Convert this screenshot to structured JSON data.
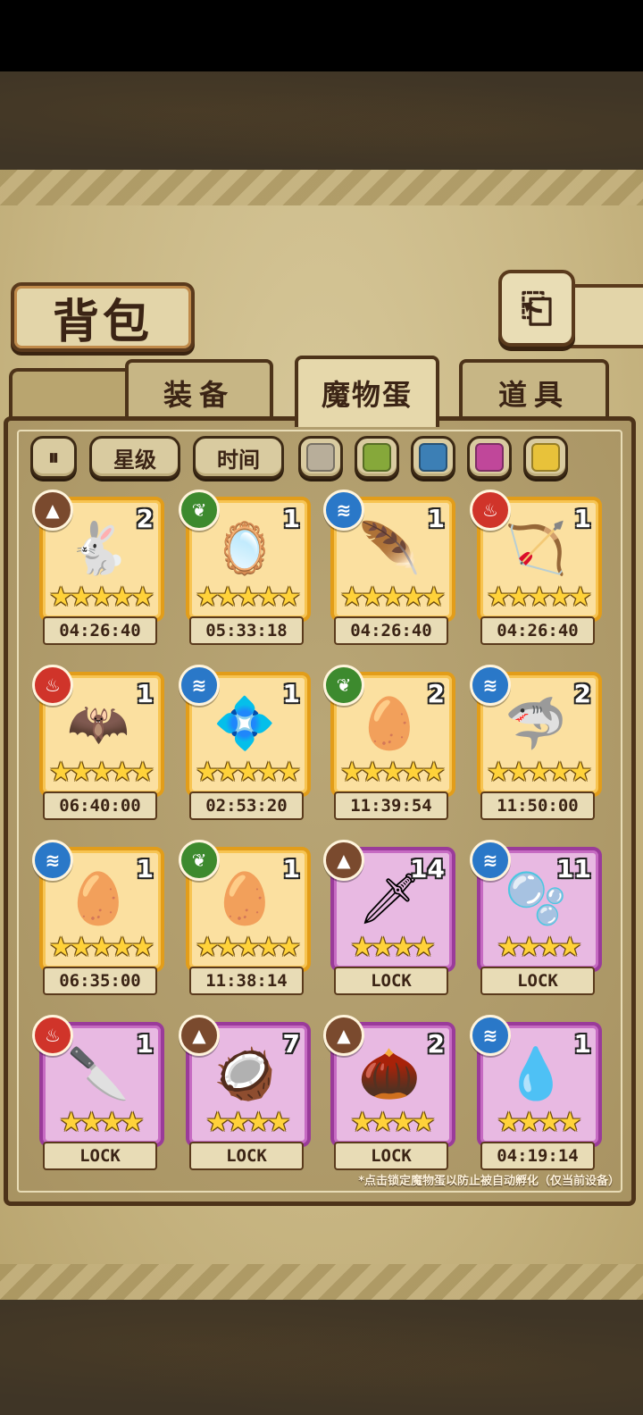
{
  "header": {
    "title": "背包",
    "back_icon": "⎗"
  },
  "tabs": [
    {
      "label": "装备",
      "active": false
    },
    {
      "label": "魔物蛋",
      "active": true
    },
    {
      "label": "道具",
      "active": false
    }
  ],
  "filters": {
    "toggle_icon": "⏸",
    "star_sort_label": "星级",
    "time_sort_label": "时间",
    "color_swatches": [
      "#b8ae9a",
      "#86a83a",
      "#3c7fb5",
      "#c0479a",
      "#e8c23a"
    ]
  },
  "element_colors": {
    "earth": "#7a4a2e",
    "nature": "#3d8a2e",
    "water": "#2a78c8",
    "fire": "#d0342a"
  },
  "element_icons": {
    "earth": "▲",
    "nature": "❦",
    "water": "≋",
    "fire": "♨"
  },
  "eggs": [
    {
      "element": "earth",
      "count": "2",
      "stars": "★★★★★",
      "timer": "04:26:40",
      "rarity": "gold",
      "art": "🐇"
    },
    {
      "element": "nature",
      "count": "1",
      "stars": "★★★★★",
      "timer": "05:33:18",
      "rarity": "gold",
      "art": "🪞"
    },
    {
      "element": "water",
      "count": "1",
      "stars": "★★★★★",
      "timer": "04:26:40",
      "rarity": "gold",
      "art": "🪶"
    },
    {
      "element": "fire",
      "count": "1",
      "stars": "★★★★★",
      "timer": "04:26:40",
      "rarity": "gold",
      "art": "🏹"
    },
    {
      "element": "fire",
      "count": "1",
      "stars": "★★★★★",
      "timer": "06:40:00",
      "rarity": "gold",
      "art": "🦇"
    },
    {
      "element": "water",
      "count": "1",
      "stars": "★★★★★",
      "timer": "02:53:20",
      "rarity": "gold",
      "art": "💠"
    },
    {
      "element": "nature",
      "count": "2",
      "stars": "★★★★★",
      "timer": "11:39:54",
      "rarity": "gold",
      "art": "🥚"
    },
    {
      "element": "water",
      "count": "2",
      "stars": "★★★★★",
      "timer": "11:50:00",
      "rarity": "gold",
      "art": "🦈"
    },
    {
      "element": "water",
      "count": "1",
      "stars": "★★★★★",
      "timer": "06:35:00",
      "rarity": "gold",
      "art": "🥚"
    },
    {
      "element": "nature",
      "count": "1",
      "stars": "★★★★★",
      "timer": "11:38:14",
      "rarity": "gold",
      "art": "🥚"
    },
    {
      "element": "earth",
      "count": "14",
      "stars": "★★★★",
      "timer": "LOCK",
      "rarity": "purple",
      "art": "🗡"
    },
    {
      "element": "water",
      "count": "11",
      "stars": "★★★★",
      "timer": "LOCK",
      "rarity": "purple",
      "art": "🫧"
    },
    {
      "element": "fire",
      "count": "1",
      "stars": "★★★★",
      "timer": "LOCK",
      "rarity": "purple",
      "art": "🔪"
    },
    {
      "element": "earth",
      "count": "7",
      "stars": "★★★★",
      "timer": "LOCK",
      "rarity": "purple",
      "art": "🥥"
    },
    {
      "element": "earth",
      "count": "2",
      "stars": "★★★★",
      "timer": "LOCK",
      "rarity": "purple",
      "art": "🌰"
    },
    {
      "element": "water",
      "count": "1",
      "stars": "★★★★",
      "timer": "04:19:14",
      "rarity": "purple",
      "art": "💧"
    }
  ],
  "footnote": "*点击锁定魔物蛋以防止被自动孵化（仅当前设备）"
}
